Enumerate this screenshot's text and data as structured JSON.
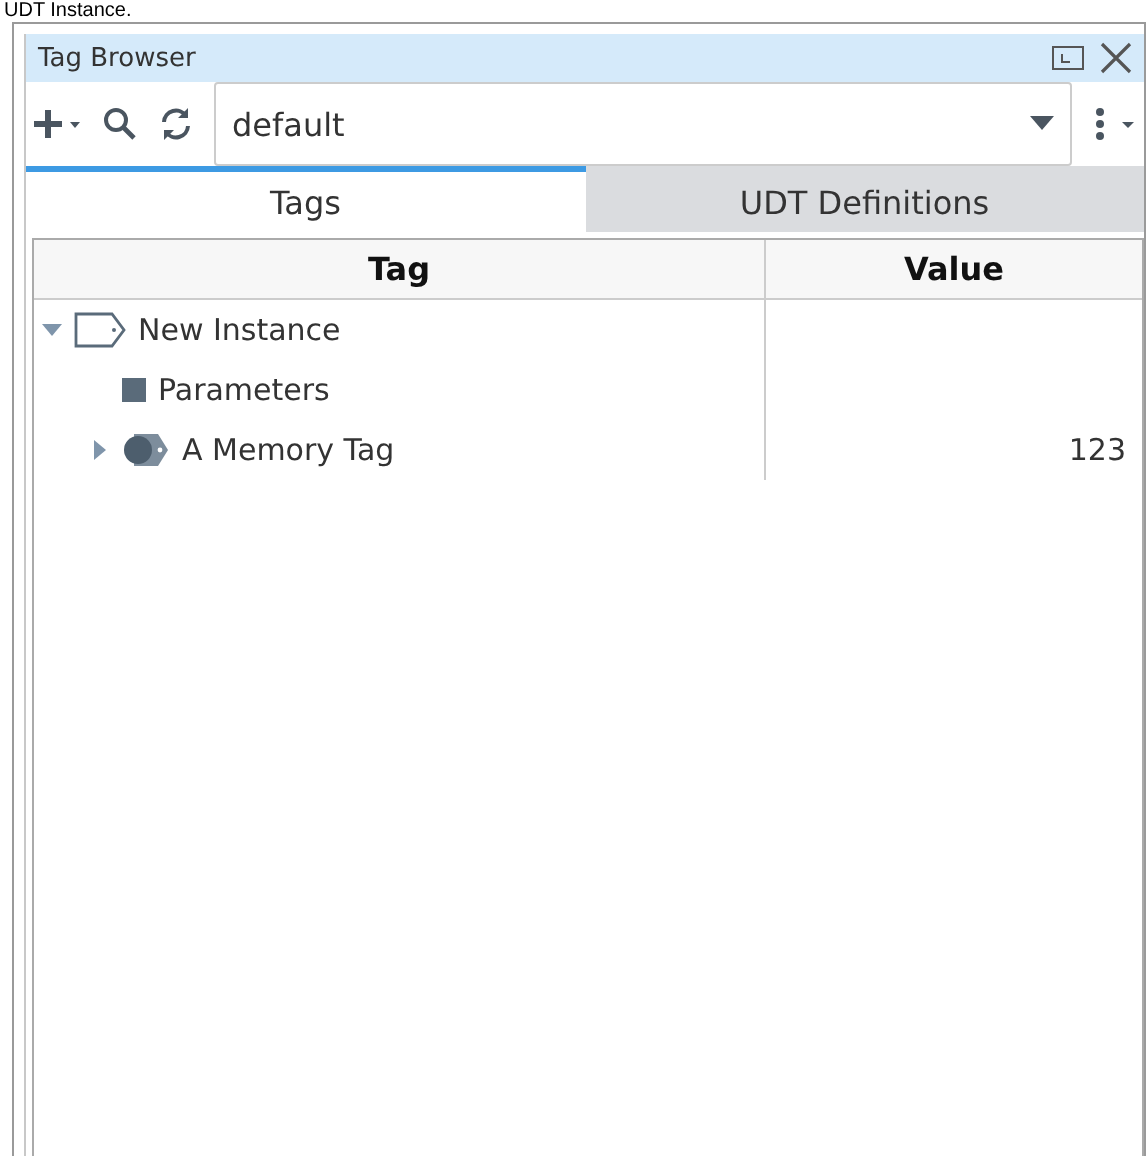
{
  "caption": "UDT Instance.",
  "panel": {
    "title": "Tag Browser"
  },
  "toolbar": {
    "provider": "default"
  },
  "tabs": [
    {
      "label": "Tags",
      "selected": true
    },
    {
      "label": "UDT Definitions",
      "selected": false
    }
  ],
  "table": {
    "columns": [
      "Tag",
      "Value"
    ],
    "rows": [
      {
        "name": "New Instance",
        "kind": "udt",
        "expanded": true,
        "children": [
          {
            "name": "Parameters",
            "kind": "folder"
          },
          {
            "name": "A Memory Tag",
            "kind": "memory",
            "value": "123",
            "expanded": false
          }
        ]
      }
    ]
  }
}
